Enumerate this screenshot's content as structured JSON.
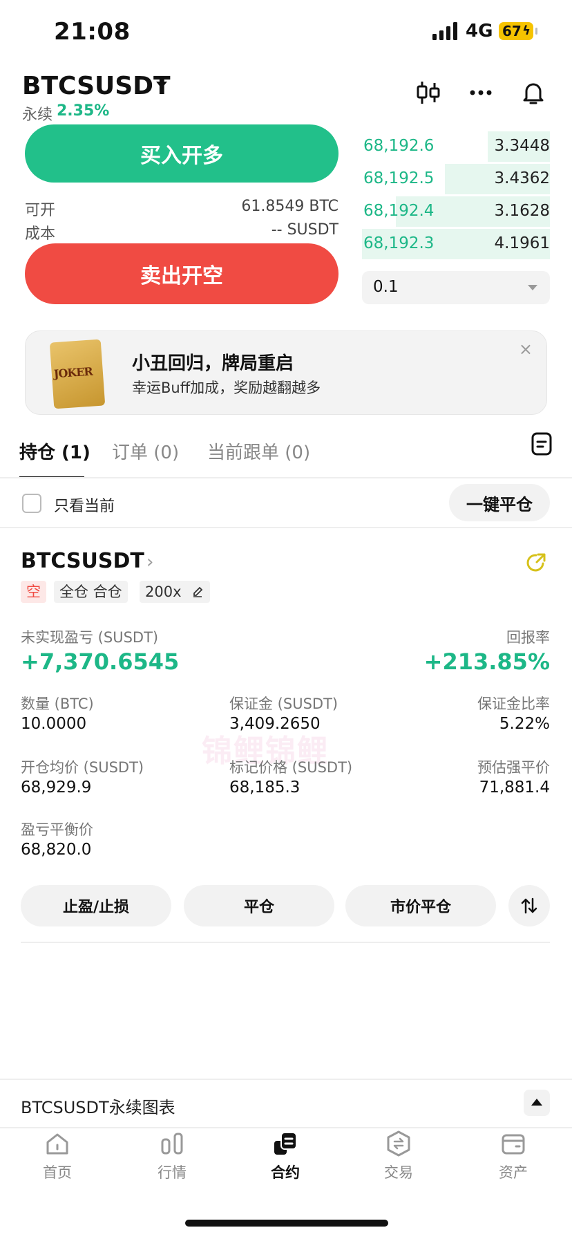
{
  "status": {
    "time": "21:08",
    "network": "4G",
    "battery": "67"
  },
  "header": {
    "pair": "BTCSUSDT",
    "perp_label": "永续",
    "change": "2.35%"
  },
  "trade": {
    "buy_label": "买入开多",
    "sell_label": "卖出开空",
    "available_label": "可开",
    "available_value": "61.8549 BTC",
    "cost_label": "成本",
    "cost_value": "-- SUSDT"
  },
  "orderbook": {
    "rows": [
      {
        "price": "68,192.6",
        "qty": "3.3448",
        "depth": 0.33
      },
      {
        "price": "68,192.5",
        "qty": "3.4362",
        "depth": 0.56
      },
      {
        "price": "68,192.4",
        "qty": "3.1628",
        "depth": 0.82
      },
      {
        "price": "68,192.3",
        "qty": "4.1961",
        "depth": 1.0
      }
    ],
    "amount_option": "0.1"
  },
  "banner": {
    "card_text": "JOKER",
    "title": "小丑回归，牌局重启",
    "subtitle": "幸运Buff加成，奖励越翻越多",
    "close": "×"
  },
  "tabs": [
    {
      "label": "持仓 (1)"
    },
    {
      "label": "订单 (0)"
    },
    {
      "label": "当前跟单 (0)"
    }
  ],
  "filter": {
    "only_current": "只看当前",
    "close_all": "一键平仓"
  },
  "position": {
    "pair": "BTCSUSDT",
    "tag_side": "空",
    "tag_margin": "全仓 合仓",
    "tag_leverage": "200x",
    "pnl_label": "未实现盈亏 (SUSDT)",
    "pnl_value": "+7,370.6545",
    "roe_label": "回报率",
    "roe_value": "+213.85%",
    "qty_label": "数量 (BTC)",
    "qty_value": "10.0000",
    "margin_label": "保证金 (SUSDT)",
    "margin_value": "3,409.2650",
    "margin_ratio_label": "保证金比率",
    "margin_ratio_value": "5.22%",
    "entry_label": "开仓均价 (SUSDT)",
    "entry_value": "68,929.9",
    "mark_label": "标记价格 (SUSDT)",
    "mark_value": "68,185.3",
    "liq_label": "预估强平价",
    "liq_value": "71,881.4",
    "breakeven_label": "盈亏平衡价",
    "breakeven_value": "68,820.0"
  },
  "actions": {
    "tp_sl": "止盈/止损",
    "close": "平仓",
    "market_close": "市价平仓"
  },
  "watermark": "锦鲤锦鲤",
  "chart_bar": {
    "title": "BTCSUSDT永续图表"
  },
  "nav": [
    {
      "label": "首页"
    },
    {
      "label": "行情"
    },
    {
      "label": "合约"
    },
    {
      "label": "交易"
    },
    {
      "label": "资产"
    }
  ],
  "colors": {
    "green": "#1db787",
    "buy": "#22c08a",
    "sell": "#f04b43"
  }
}
